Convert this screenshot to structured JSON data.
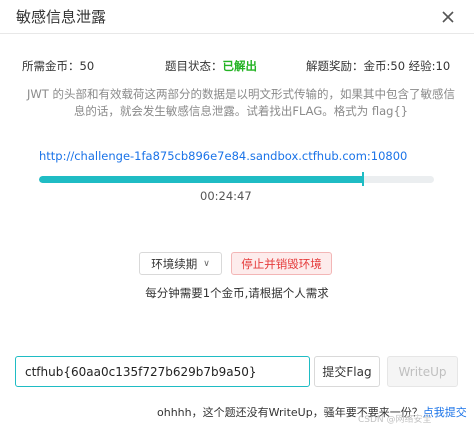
{
  "dialog": {
    "title": "敏感信息泄露"
  },
  "info": {
    "cost_label": "所需金币：50",
    "status_prefix": "题目状态：",
    "status_value": "已解出",
    "status_color": "#24b324",
    "reward_label": "解题奖励：金币:50 经验:10"
  },
  "description": "JWT 的头部和有效载荷这两部分的数据是以明文形式传输的，如果其中包含了敏感信息的话，就会发生敏感信息泄露。试着找出FLAG。格式为 flag{}",
  "environment": {
    "url": "http://challenge-1fa875cb896e7e84.sandbox.ctfhub.com:10800",
    "progress_fraction": 0.82,
    "timer": "00:24:47",
    "accent_color": "#1fbcc4"
  },
  "actions": {
    "renew_label": "环境续期",
    "stop_label": "停止并销毁环境",
    "hint": "每分钟需要1个金币,请根据个人需求"
  },
  "flag_form": {
    "value": "ctfhub{60aa0c135f727b629b7b9a50}",
    "submit_label": "提交Flag",
    "writeup_label": "WriteUp"
  },
  "footer": {
    "note": "ohhhh，这个题还没有WriteUp，骚年要不要来一份？",
    "link_label": "点我提交",
    "watermark": "CSDN @网络安全"
  },
  "icons": {
    "close": "close-icon",
    "renew_dropdown": "chevron-down-icon"
  }
}
